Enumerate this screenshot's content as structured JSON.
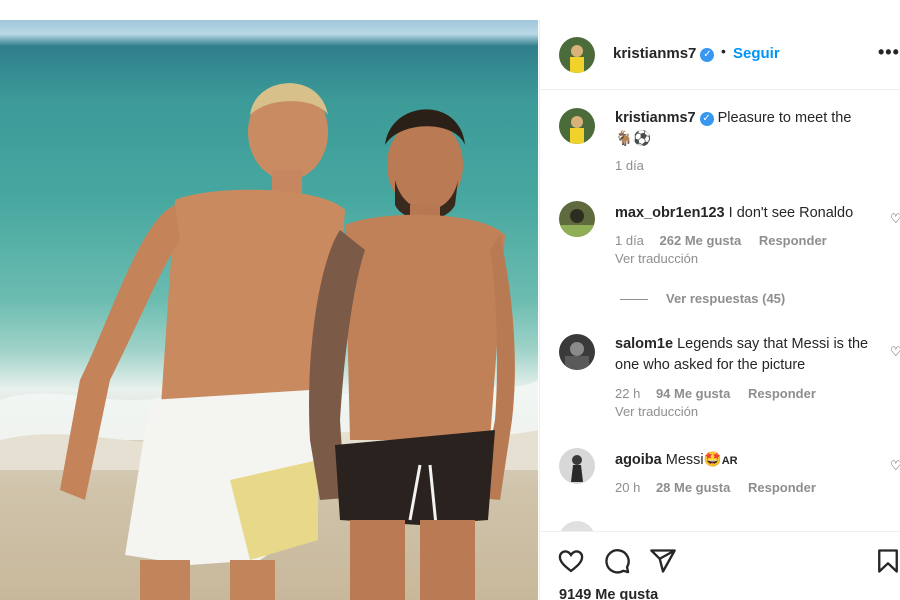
{
  "post": {
    "author": "kristianms7",
    "separator": "•",
    "follow_label": "Seguir",
    "more_label": "•••"
  },
  "caption": {
    "user": "kristianms7",
    "text": "Pleasure to meet the",
    "emojis": "🐐⚽",
    "time": "1 día"
  },
  "comments": [
    {
      "user": "max_obr1en123",
      "text": "I don't see Ronaldo",
      "time": "1 día",
      "likes": "262 Me gusta",
      "reply": "Responder",
      "translate": "Ver traducción",
      "view_replies": "Ver respuestas (45)"
    },
    {
      "user": "salom1e",
      "text": "Legends say that Messi is the one who asked for the picture",
      "time": "22 h",
      "likes": "94 Me gusta",
      "reply": "Responder",
      "translate": "Ver traducción"
    },
    {
      "user": "agoiba",
      "text": "Messi🤩",
      "flag": "AR",
      "time": "20 h",
      "likes": "28 Me gusta",
      "reply": "Responder"
    }
  ],
  "footer": {
    "likes": "9149 Me gusta"
  },
  "icons": [
    "heart-icon",
    "comment-icon",
    "share-icon",
    "bookmark-icon",
    "verified-badge-icon",
    "more-options-icon"
  ],
  "colors": {
    "link_blue": "#0095f6",
    "verified_blue": "#3897f0",
    "muted_text": "#8e8e8e"
  }
}
